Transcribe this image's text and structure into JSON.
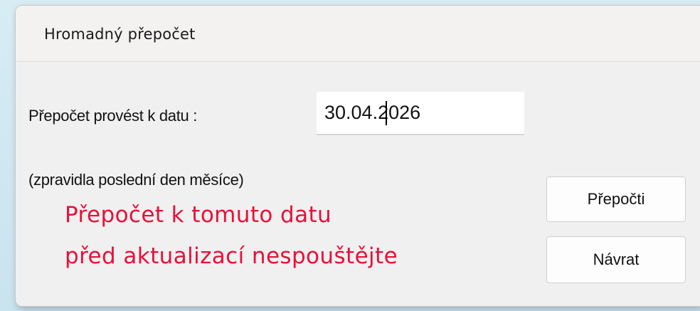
{
  "window": {
    "title": "Hromadný přepočet"
  },
  "form": {
    "date_label": "Přepočet provést k datu :",
    "date_value": "30.04.2026",
    "hint": "(zpravidla poslední den měsíce)"
  },
  "warning": {
    "line1": "Přepočet k tomuto datu",
    "line2": "před aktualizací nespouštějte",
    "color": "#e8103a"
  },
  "buttons": {
    "recalculate": "Přepočti",
    "back": "Návrat"
  }
}
